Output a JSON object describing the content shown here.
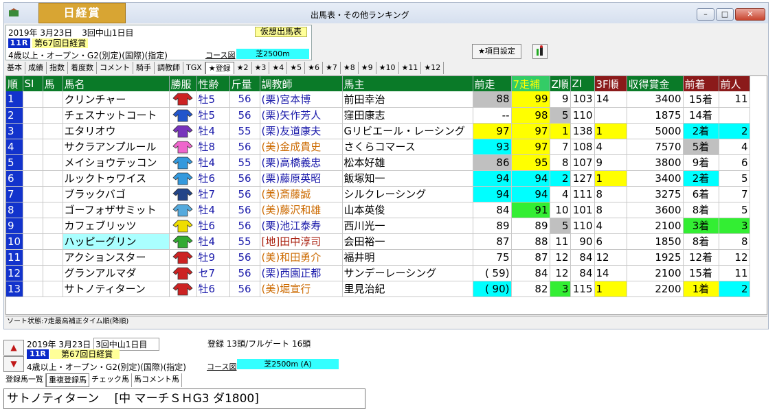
{
  "window": {
    "race_tab": "日経賞",
    "title": "出馬表・その他ランキング"
  },
  "info": {
    "date": "2019年  3月23日",
    "meet": "3回中山1日目",
    "yoso": "仮想出馬表",
    "race_no": "11R",
    "race_name": "第67回日経賞",
    "condition": "4歳以上・オープン・G2(別定)(国際)(指定)",
    "course_label": "コース図",
    "surface": "芝2500m"
  },
  "toolbar": {
    "config_label": "★項目設定"
  },
  "tabs": [
    "基本",
    "成績",
    "指数",
    "着度数",
    "コメント",
    "騎手",
    "調教師",
    "TGX",
    "★登録",
    "★2",
    "★3",
    "★4",
    "★5",
    "★6",
    "★7",
    "★8",
    "★9",
    "★10",
    "★11",
    "★12"
  ],
  "table": {
    "columns": [
      "順",
      "SI",
      "馬",
      "馬名",
      "勝服",
      "性齢",
      "斤量",
      "調教師",
      "馬主",
      "前走",
      "7走補",
      "Z順",
      "ZI",
      "3F順",
      "収得賞金",
      "前着",
      "前人"
    ],
    "rows": [
      {
        "n": "1",
        "name": "クリンチャー",
        "silk": "#cc2222",
        "sex": "牡5",
        "kin": "56",
        "aff": "(栗)",
        "tr": "宮本博",
        "owner": "前田幸治",
        "prev": "88",
        "prev_bg": "g",
        "s7": "99",
        "s7_bg": "y",
        "z": "9",
        "z_bg": "",
        "zi": "103",
        "f3": "14",
        "f3_bg": "",
        "prize": "3400",
        "chaku": "15着",
        "chaku_bg": "",
        "pop": "11",
        "pop_bg": ""
      },
      {
        "n": "2",
        "name": "チェスナットコート",
        "silk": "#2255cc",
        "sex": "牡5",
        "kin": "56",
        "aff": "(栗)",
        "tr": "矢作芳人",
        "owner": "窪田康志",
        "prev": "--",
        "prev_bg": "",
        "s7": "98",
        "s7_bg": "y",
        "z": "5",
        "z_bg": "g",
        "zi": "110",
        "f3": "",
        "f3_bg": "",
        "prize": "1875",
        "chaku": "14着",
        "chaku_bg": "",
        "pop": "",
        "pop_bg": ""
      },
      {
        "n": "3",
        "name": "エタリオウ",
        "silk": "#7733bb",
        "sex": "牡4",
        "kin": "55",
        "aff": "(栗)",
        "tr": "友道康夫",
        "owner": "Gリビエール・レーシング",
        "prev": "97",
        "prev_bg": "y",
        "s7": "97",
        "s7_bg": "y",
        "z": "1",
        "z_bg": "y",
        "zi": "138",
        "f3": "1",
        "f3_bg": "y",
        "prize": "5000",
        "chaku": "2着",
        "chaku_bg": "c",
        "pop": "2",
        "pop_bg": "c"
      },
      {
        "n": "4",
        "name": "サクラアンプルール",
        "silk": "#ee66cc",
        "sex": "牡8",
        "kin": "56",
        "aff": "(美)",
        "tr": "金成貴史",
        "owner": "さくらコマース",
        "prev": "93",
        "prev_bg": "c",
        "s7": "97",
        "s7_bg": "y",
        "z": "7",
        "z_bg": "",
        "zi": "108",
        "f3": "4",
        "f3_bg": "",
        "prize": "7570",
        "chaku": "5着",
        "chaku_bg": "g",
        "pop": "4",
        "pop_bg": ""
      },
      {
        "n": "5",
        "name": "メイショウテッコン",
        "silk": "#3399dd",
        "sex": "牡4",
        "kin": "55",
        "aff": "(栗)",
        "tr": "高橋義忠",
        "owner": "松本好雄",
        "prev": "86",
        "prev_bg": "g",
        "s7": "95",
        "s7_bg": "y",
        "z": "8",
        "z_bg": "",
        "zi": "107",
        "f3": "9",
        "f3_bg": "",
        "prize": "3800",
        "chaku": "9着",
        "chaku_bg": "",
        "pop": "6",
        "pop_bg": ""
      },
      {
        "n": "6",
        "name": "ルックトゥワイス",
        "silk": "#3399dd",
        "sex": "牡6",
        "kin": "56",
        "aff": "(栗)",
        "tr": "藤原英昭",
        "owner": "飯塚知一",
        "prev": "94",
        "prev_bg": "c",
        "s7": "94",
        "s7_bg": "c",
        "z": "2",
        "z_bg": "c",
        "zi": "127",
        "f3": "1",
        "f3_bg": "y",
        "prize": "3400",
        "chaku": "2着",
        "chaku_bg": "c",
        "pop": "5",
        "pop_bg": ""
      },
      {
        "n": "7",
        "name": "ブラックバゴ",
        "silk": "#224488",
        "sex": "牡7",
        "kin": "56",
        "aff": "(美)",
        "tr": "斎藤誠",
        "owner": "シルクレーシング",
        "prev": "94",
        "prev_bg": "c",
        "s7": "94",
        "s7_bg": "c",
        "z": "4",
        "z_bg": "",
        "zi": "111",
        "f3": "8",
        "f3_bg": "",
        "prize": "3275",
        "chaku": "6着",
        "chaku_bg": "",
        "pop": "7",
        "pop_bg": ""
      },
      {
        "n": "8",
        "name": "ゴーフォザサミット",
        "silk": "#55aadd",
        "sex": "牡4",
        "kin": "56",
        "aff": "(美)",
        "tr": "藤沢和雄",
        "owner": "山本英俊",
        "prev": "84",
        "prev_bg": "",
        "s7": "91",
        "s7_bg": "gr",
        "z": "10",
        "z_bg": "",
        "zi": "101",
        "f3": "8",
        "f3_bg": "",
        "prize": "3600",
        "chaku": "8着",
        "chaku_bg": "",
        "pop": "5",
        "pop_bg": ""
      },
      {
        "n": "9",
        "name": "カフェブリッツ",
        "silk": "#eedd00",
        "sex": "牡6",
        "kin": "56",
        "aff": "(栗)",
        "tr": "池江泰寿",
        "owner": "西川光一",
        "prev": "89",
        "prev_bg": "",
        "s7": "89",
        "s7_bg": "",
        "z": "5",
        "z_bg": "g",
        "zi": "110",
        "f3": "4",
        "f3_bg": "",
        "prize": "2100",
        "chaku": "3着",
        "chaku_bg": "gr",
        "pop": "3",
        "pop_bg": "gr"
      },
      {
        "n": "10",
        "name": "ハッピーグリン",
        "silk": "#33aa33",
        "sex": "牡4",
        "kin": "55",
        "aff": "[地]",
        "tr": "田中淳司",
        "owner": "会田裕一",
        "prev": "87",
        "prev_bg": "",
        "s7": "88",
        "s7_bg": "",
        "z": "11",
        "z_bg": "",
        "zi": "90",
        "f3": "6",
        "f3_bg": "",
        "prize": "1850",
        "chaku": "8着",
        "chaku_bg": "",
        "pop": "8",
        "pop_bg": ""
      },
      {
        "n": "11",
        "name": "アクションスター",
        "silk": "#cc2222",
        "sex": "牡9",
        "kin": "56",
        "aff": "(美)",
        "tr": "和田勇介",
        "owner": "福井明",
        "prev": "75",
        "prev_bg": "",
        "s7": "87",
        "s7_bg": "",
        "z": "12",
        "z_bg": "",
        "zi": "84",
        "f3": "12",
        "f3_bg": "",
        "prize": "1925",
        "chaku": "12着",
        "chaku_bg": "",
        "pop": "12",
        "pop_bg": ""
      },
      {
        "n": "12",
        "name": "グランアルマダ",
        "silk": "#cc2222",
        "sex": "セ7",
        "kin": "56",
        "aff": "(栗)",
        "tr": "西園正都",
        "owner": "サンデーレーシング",
        "prev": "( 59)",
        "prev_bg": "",
        "s7": "84",
        "s7_bg": "",
        "z": "12",
        "z_bg": "",
        "zi": "84",
        "f3": "14",
        "f3_bg": "",
        "prize": "2100",
        "chaku": "15着",
        "chaku_bg": "",
        "pop": "11",
        "pop_bg": ""
      },
      {
        "n": "13",
        "name": "サトノティターン",
        "silk": "#cc2222",
        "sex": "牡6",
        "kin": "56",
        "aff": "(美)",
        "tr": "堀宣行",
        "owner": "里見治紀",
        "prev": "( 90)",
        "prev_bg": "c",
        "s7": "82",
        "s7_bg": "",
        "z": "3",
        "z_bg": "gr",
        "zi": "115",
        "f3": "1",
        "f3_bg": "y",
        "prize": "2200",
        "chaku": "1着",
        "chaku_bg": "y",
        "pop": "2",
        "pop_bg": "c"
      }
    ]
  },
  "status": "ソート状態:7走最高補正タイム順(降順)",
  "lower": {
    "date": "2019年  3月23日",
    "meet": "3回中山1日目",
    "registration": "登録 13頭/フルゲート 16頭",
    "race_no": "11R",
    "race_name": "第67回日経賞",
    "condition": "4歳以上・オープン・G2(別定)(国際)(指定)",
    "course_label": "コース図",
    "surface": "芝2500m (A)",
    "tabs": [
      "登録馬一覧",
      "重複登録馬",
      "チェック馬",
      "馬コメント馬"
    ],
    "memo": "サトノティターン　 [中 マーチＳＨG3 ダ1800]"
  },
  "colors": {
    "header_green": "#0a7a28",
    "row_num_blue": "#1233cc",
    "highlight_yellow": "#ffff00",
    "highlight_cyan": "#00ffff",
    "highlight_green": "#33ee33",
    "race_tab_gold": "#d8a533"
  }
}
